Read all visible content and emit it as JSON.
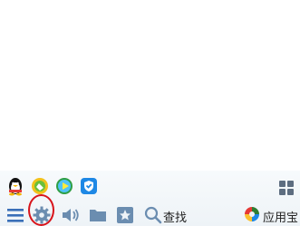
{
  "taskbar": {
    "pinned_apps": [
      "qq-penguin-icon",
      "cloud-music-icon",
      "media-player-icon",
      "security-shield-icon"
    ],
    "app_grid_icon": "app-grid-icon",
    "tools": [
      "menu-icon",
      "gear-icon",
      "speaker-icon",
      "folder-icon",
      "star-icon",
      "search-icon"
    ],
    "search_label": "查找",
    "app_store_label": "应用宝",
    "highlight_color": "#d8141b",
    "accent_color": "#3a6fb8"
  }
}
